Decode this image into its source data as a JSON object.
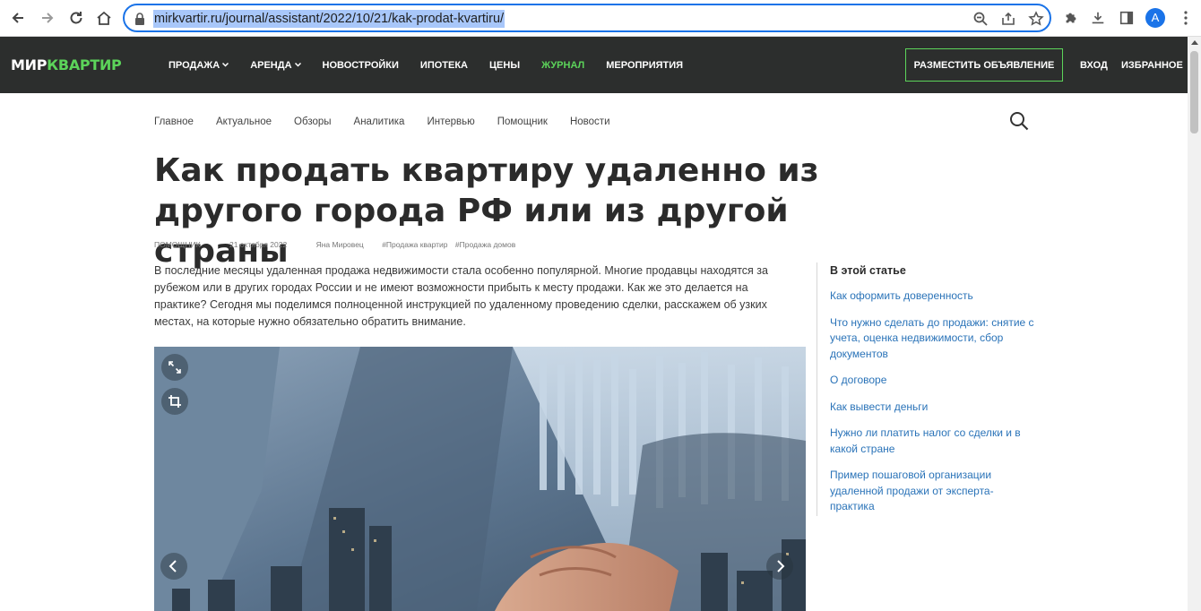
{
  "browser": {
    "url": "mirkvartir.ru/journal/assistant/2022/10/21/kak-prodat-kvartiru/",
    "profile_initial": "A"
  },
  "site": {
    "logo_part1": "МИР",
    "logo_part2": "КВАРТИР",
    "nav": [
      {
        "label": "ПРОДАЖА",
        "dropdown": true
      },
      {
        "label": "АРЕНДА",
        "dropdown": true
      },
      {
        "label": "НОВОСТРОЙКИ"
      },
      {
        "label": "ИПОТЕКА"
      },
      {
        "label": "ЦЕНЫ"
      },
      {
        "label": "ЖУРНАЛ",
        "active": true
      },
      {
        "label": "МЕРОПРИЯТИЯ"
      }
    ],
    "post_button": "РАЗМЕСТИТЬ ОБЪЯВЛЕНИЕ",
    "login": "ВХОД",
    "favorites": "ИЗБРАННОЕ",
    "accent_color": "#5cd45a",
    "header_bg": "#2c2e2d"
  },
  "subnav": [
    "Главное",
    "Актуальное",
    "Обзоры",
    "Аналитика",
    "Интервью",
    "Помощник",
    "Новости"
  ],
  "article": {
    "title": "Как продать квартиру удаленно из другого города РФ или из другой страны",
    "category": "ПОМОЩНИК",
    "date": "21 октября 2022",
    "author": "Яна Мировец",
    "tags": [
      "#Продажа квартир",
      "#Продажа домов"
    ],
    "lead": "В последние месяцы удаленная продажа недвижимости стала особенно популярной. Многие продавцы находятся за рубежом или в других городах России и не имеют возможности прибыть к месту продажи. Как же это делается на практике? Сегодня мы поделимся полноценной инструкцией по удаленному проведению сделки, расскажем об узких местах, на которые нужно обязательно обратить внимание."
  },
  "toc": {
    "title": "В этой статье",
    "items": [
      "Как оформить доверенность",
      "Что нужно сделать до продажи: снятие с учета, оценка недвижимости, сбор документов",
      "О договоре",
      "Как вывести деньги",
      "Нужно ли платить налог со сделки и в какой стране",
      "Пример пошаговой организации удаленной продажи от эксперта-практика"
    ],
    "link_color": "#2a73b8"
  }
}
